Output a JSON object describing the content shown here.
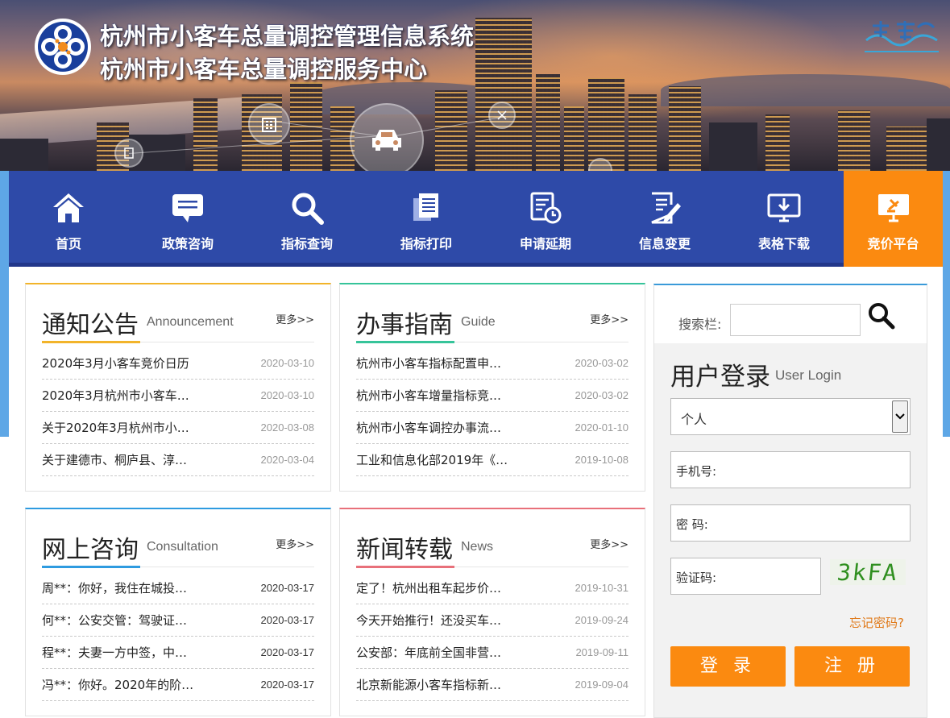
{
  "header": {
    "title_line1": "杭州市小客车总量调控管理信息系统",
    "title_line2": "杭州市小客车总量调控服务中心"
  },
  "nav": {
    "items": [
      {
        "label": "首页",
        "icon": "home-icon"
      },
      {
        "label": "政策咨询",
        "icon": "chat-icon"
      },
      {
        "label": "指标查询",
        "icon": "search-icon"
      },
      {
        "label": "指标打印",
        "icon": "print-icon"
      },
      {
        "label": "申请延期",
        "icon": "calendar-clock-icon"
      },
      {
        "label": "信息变更",
        "icon": "edit-doc-icon"
      },
      {
        "label": "表格下载",
        "icon": "download-icon"
      }
    ],
    "active": {
      "label": "竞价平台",
      "icon": "bidding-icon"
    }
  },
  "panels": {
    "announcement": {
      "title": "通知公告",
      "subtitle": "Announcement",
      "more": "更多>>",
      "accent": "#f2b42a",
      "items": [
        {
          "title": "2020年3月小客车竞价日历",
          "date": "2020-03-10"
        },
        {
          "title": "2020年3月杭州市小客车…",
          "date": "2020-03-10"
        },
        {
          "title": "关于2020年3月杭州市小…",
          "date": "2020-03-08"
        },
        {
          "title": "关于建德市、桐庐县、淳…",
          "date": "2020-03-04"
        }
      ]
    },
    "guide": {
      "title": "办事指南",
      "subtitle": "Guide",
      "more": "更多>>",
      "accent": "#36c49a",
      "items": [
        {
          "title": "杭州市小客车指标配置申…",
          "date": "2020-03-02"
        },
        {
          "title": "杭州市小客车增量指标竞…",
          "date": "2020-03-02"
        },
        {
          "title": "杭州市小客车调控办事流…",
          "date": "2020-01-10"
        },
        {
          "title": "工业和信息化部2019年《…",
          "date": "2019-10-08"
        }
      ]
    },
    "consultation": {
      "title": "网上咨询",
      "subtitle": "Consultation",
      "more": "更多>>",
      "accent": "#2e9be0",
      "items": [
        {
          "title": "周**：你好，我住在城投…",
          "date": "2020-03-17"
        },
        {
          "title": "何**：公安交管：驾驶证…",
          "date": "2020-03-17"
        },
        {
          "title": "程**：夫妻一方中签，中…",
          "date": "2020-03-17"
        },
        {
          "title": "冯**：你好。2020年的阶…",
          "date": "2020-03-17"
        }
      ]
    },
    "news": {
      "title": "新闻转载",
      "subtitle": "News",
      "more": "更多>>",
      "accent": "#e8707a",
      "items": [
        {
          "title": "定了！杭州出租车起步价…",
          "date": "2019-10-31"
        },
        {
          "title": "今天开始推行！还没买车…",
          "date": "2019-09-24"
        },
        {
          "title": "公安部：年底前全国非营…",
          "date": "2019-09-11"
        },
        {
          "title": "北京新能源小客车指标新…",
          "date": "2019-09-04"
        }
      ]
    }
  },
  "search": {
    "label": "搜索栏:",
    "value": ""
  },
  "login": {
    "title": "用户登录",
    "subtitle": "User Login",
    "user_type": "个人",
    "phone_label": "手机号:",
    "password_label": "密 码:",
    "captcha_label": "验证码:",
    "captcha_text": "3kFA",
    "forgot": "忘记密码?",
    "login_button": "登 录",
    "register_button": "注 册"
  },
  "colors": {
    "nav_blue": "#2e4aa8",
    "accent_orange": "#fb8a10"
  }
}
